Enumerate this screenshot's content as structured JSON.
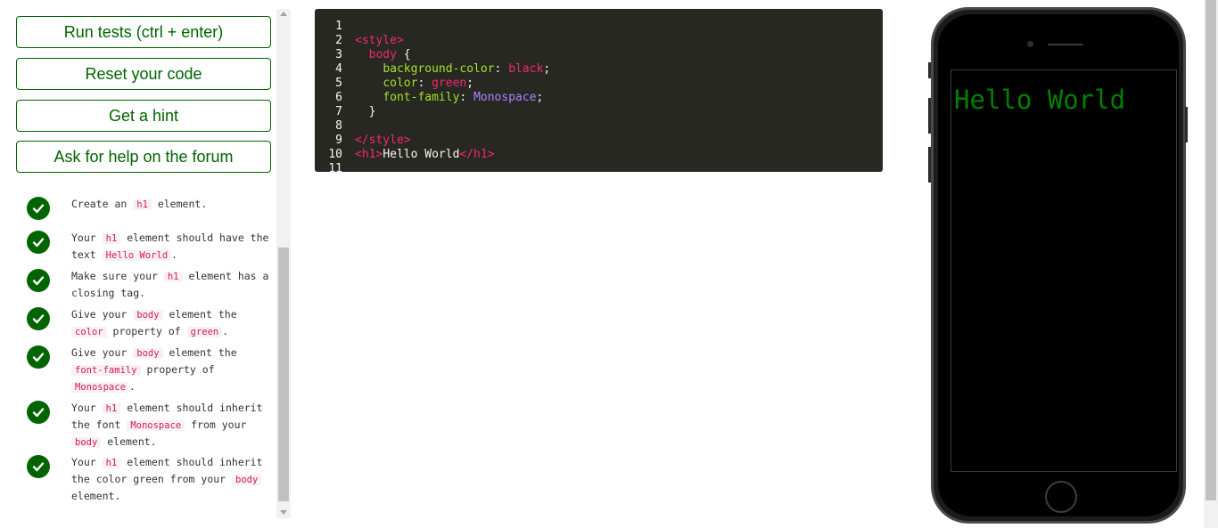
{
  "buttons": {
    "run": "Run tests (ctrl + enter)",
    "reset": "Reset your code",
    "hint": "Get a hint",
    "forum": "Ask for help on the forum"
  },
  "tests": [
    {
      "passed": true,
      "parts": [
        {
          "t": "Create an "
        },
        {
          "c": "h1"
        },
        {
          "t": " element."
        }
      ]
    },
    {
      "passed": true,
      "parts": [
        {
          "t": "Your "
        },
        {
          "c": "h1"
        },
        {
          "t": " element should have the text "
        },
        {
          "c": "Hello World"
        },
        {
          "t": "."
        }
      ]
    },
    {
      "passed": true,
      "parts": [
        {
          "t": "Make sure your "
        },
        {
          "c": "h1"
        },
        {
          "t": " element has a closing tag."
        }
      ]
    },
    {
      "passed": true,
      "parts": [
        {
          "t": "Give your "
        },
        {
          "c": "body"
        },
        {
          "t": " element the "
        },
        {
          "c": "color"
        },
        {
          "t": " property of "
        },
        {
          "c": "green"
        },
        {
          "t": "."
        }
      ]
    },
    {
      "passed": true,
      "parts": [
        {
          "t": "Give your "
        },
        {
          "c": "body"
        },
        {
          "t": " element the "
        },
        {
          "c": "font-family"
        },
        {
          "t": " property of "
        },
        {
          "c": "Monospace"
        },
        {
          "t": "."
        }
      ]
    },
    {
      "passed": true,
      "parts": [
        {
          "t": "Your "
        },
        {
          "c": "h1"
        },
        {
          "t": " element should inherit the font "
        },
        {
          "c": "Monospace"
        },
        {
          "t": " from your "
        },
        {
          "c": "body"
        },
        {
          "t": " element."
        }
      ]
    },
    {
      "passed": true,
      "parts": [
        {
          "t": "Your "
        },
        {
          "c": "h1"
        },
        {
          "t": " element should inherit the color green from your "
        },
        {
          "c": "body"
        },
        {
          "t": " element."
        }
      ]
    }
  ],
  "editor": {
    "lines": [
      [],
      [
        {
          "cls": "tag",
          "t": "<style>"
        }
      ],
      [
        {
          "cls": "txt",
          "t": "  "
        },
        {
          "cls": "sel",
          "t": "body"
        },
        {
          "cls": "txt",
          "t": " {"
        }
      ],
      [
        {
          "cls": "txt",
          "t": "    "
        },
        {
          "cls": "prop",
          "t": "background-color"
        },
        {
          "cls": "txt",
          "t": ": "
        },
        {
          "cls": "val-kw",
          "t": "black"
        },
        {
          "cls": "txt",
          "t": ";"
        }
      ],
      [
        {
          "cls": "txt",
          "t": "    "
        },
        {
          "cls": "prop",
          "t": "color"
        },
        {
          "cls": "txt",
          "t": ": "
        },
        {
          "cls": "val-kw",
          "t": "green"
        },
        {
          "cls": "txt",
          "t": ";"
        }
      ],
      [
        {
          "cls": "txt",
          "t": "    "
        },
        {
          "cls": "prop",
          "t": "font-family"
        },
        {
          "cls": "txt",
          "t": ": "
        },
        {
          "cls": "val-font",
          "t": "Monospace"
        },
        {
          "cls": "txt",
          "t": ";"
        }
      ],
      [
        {
          "cls": "txt",
          "t": "  }"
        }
      ],
      [],
      [
        {
          "cls": "tag",
          "t": "</style>"
        }
      ],
      [
        {
          "cls": "tag",
          "t": "<h1>"
        },
        {
          "cls": "txt",
          "t": "Hello World"
        },
        {
          "cls": "tag",
          "t": "</h1>"
        }
      ],
      []
    ]
  },
  "preview": {
    "heading": "Hello World"
  },
  "colors": {
    "accent": "#006400",
    "editor_bg": "#272822",
    "preview_text": "#008000"
  }
}
